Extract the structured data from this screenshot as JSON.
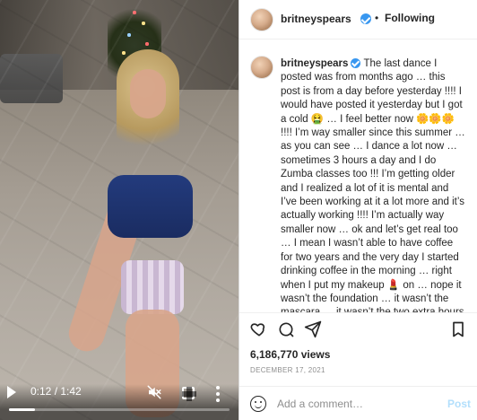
{
  "video": {
    "time": "0:12 / 1:42",
    "progress": 0.117647
  },
  "header": {
    "username": "britneyspears",
    "separator": "•",
    "following": "Following"
  },
  "caption": {
    "username": "britneyspears",
    "text": "The last dance I posted was from months ago … this post is from a day before yesterday !!!! I would have posted it yesterday but I got a cold 🤮 … I feel better now 🌼🌼🌼 !!!! I’m way smaller since this summer … as you can see … I dance a lot now … sometimes 3 hours a day and I do Zumba classes too !!! I’m getting older and I realized a lot of it is mental and I’ve been working at it a lot more and it’s actually working !!!! I’m actually way smaller now … ok and let’s get real too … I mean I wasn’t able to have coffee for two years and the very day I started drinking coffee in the morning … right when I put my makeup 💄 on … nope it wasn’t the foundation … it wasn’t the mascara … it wasn’t the two extra hours of sleep … it wasn’t the blush"
  },
  "stats": {
    "views": "6,186,770 views",
    "date": "DECEMBER 17, 2021"
  },
  "comment": {
    "placeholder": "Add a comment…",
    "post_label": "Post"
  },
  "icons": {
    "play": "play-icon",
    "mute": "muted-speaker-icon",
    "fullscreen": "fullscreen-icon",
    "more": "more-vertical-icon",
    "heart": "heart-icon",
    "comment": "comment-icon",
    "share": "share-icon",
    "bookmark": "bookmark-icon",
    "emoji": "emoji-icon"
  },
  "colors": {
    "verified": "#3897f0",
    "post_disabled": "#b2dffc",
    "text": "#262626",
    "muted": "#8e8e8e"
  }
}
